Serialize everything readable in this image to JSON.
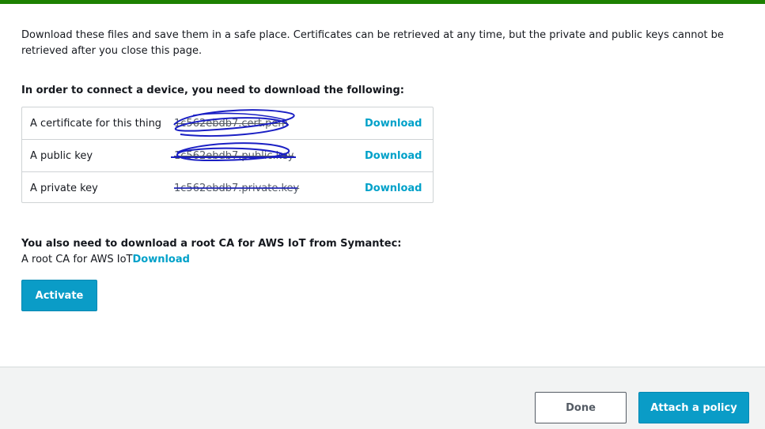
{
  "intro_text": "Download these files and save them in a safe place. Certificates can be retrieved at any time, but the private and public keys cannot be retrieved after you close this page.",
  "download_heading": "In order to connect a device, you need to download the following:",
  "files": [
    {
      "label": "A certificate for this thing",
      "filename": "1c562ebdb7.cert.pem",
      "action": "Download"
    },
    {
      "label": "A public key",
      "filename": "1c562ebdb7.public.key",
      "action": "Download"
    },
    {
      "label": "A private key",
      "filename": "1c562ebdb7.private.key",
      "action": "Download"
    }
  ],
  "root_ca": {
    "heading": "You also need to download a root CA for AWS IoT from Symantec:",
    "label": "A root CA for AWS IoT",
    "link": "Download"
  },
  "activate_label": "Activate",
  "footer": {
    "done_label": "Done",
    "attach_label": "Attach a policy"
  },
  "colors": {
    "accent_bar": "#1d8102",
    "link": "#00a1c9",
    "primary_button": "#0a9cc7",
    "scribble": "#1a1fc4"
  }
}
